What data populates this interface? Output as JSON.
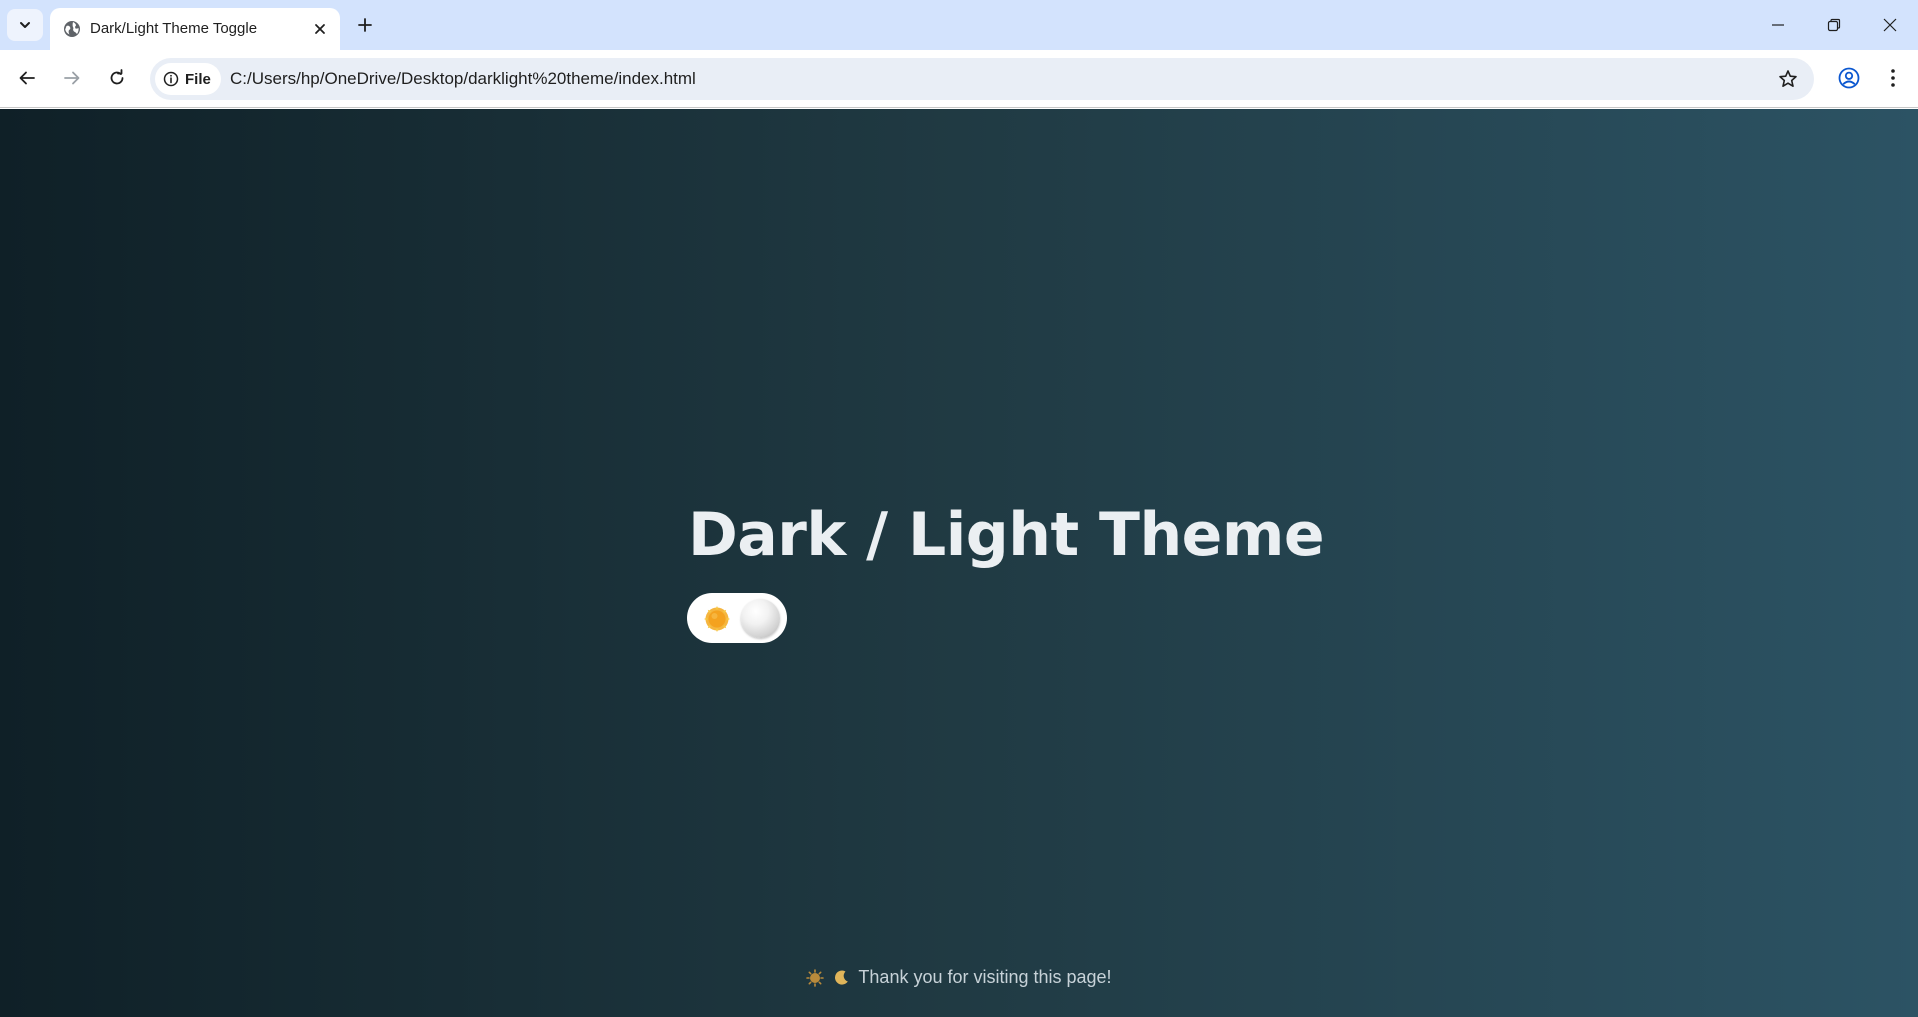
{
  "browser": {
    "tab": {
      "title": "Dark/Light Theme Toggle"
    },
    "address_bar": {
      "chip_label": "File",
      "url": "C:/Users/hp/OneDrive/Desktop/darklight%20theme/index.html"
    }
  },
  "page": {
    "title": "Dark / Light Theme",
    "toggle": {
      "state": "dark",
      "left_icon": "sun-icon",
      "knob_icon": "moon-knob"
    },
    "footer": {
      "icons": [
        "sun-icon",
        "moon-icon"
      ],
      "text": "Thank you for visiting this page!"
    },
    "colors": {
      "gradient_start": "#0f2027",
      "gradient_mid": "#203a43",
      "gradient_end": "#2c5364",
      "title": "#ebeff2",
      "chrome_tabstrip": "#d3e3fd"
    }
  }
}
